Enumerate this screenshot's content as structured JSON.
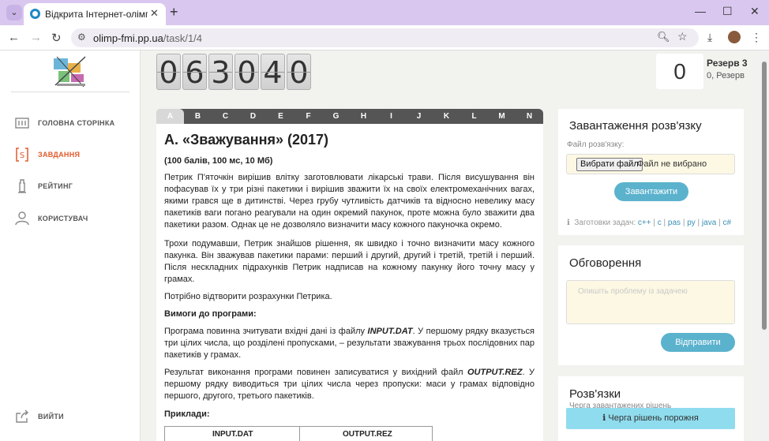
{
  "browser": {
    "tab_title": "Відкрита Інтернет-олімпіада Р",
    "url_host": "olimp-fmi.pp.ua",
    "url_path": "/task/1/4"
  },
  "sidebar": {
    "items": [
      {
        "label": "ГОЛОВНА СТОРІНКА",
        "icon": "dashboard-icon"
      },
      {
        "label": "ЗАВДАННЯ",
        "icon": "brackets-icon"
      },
      {
        "label": "РЕЙТИНГ",
        "icon": "tower-icon"
      },
      {
        "label": "КОРИСТУВАЧ",
        "icon": "user-icon"
      }
    ],
    "logout": "ВИЙТИ"
  },
  "timer": {
    "digits": [
      "0",
      "6",
      "3",
      "0",
      "4",
      "0"
    ]
  },
  "score": {
    "value": "0",
    "title": "Резерв 3",
    "subtitle": "0, Резерв"
  },
  "task_tabs": [
    "A",
    "B",
    "C",
    "D",
    "E",
    "F",
    "G",
    "H",
    "I",
    "J",
    "K",
    "L",
    "M",
    "N"
  ],
  "task": {
    "title": "A. «Зважування» (2017)",
    "limits": "(100 балів, 100 мс, 10 Мб)",
    "p1": "Петрик П'яточкін вирішив влітку заготовлювати лікарські трави. Після висушування він пофасував їх у три різні пакетики і вирішив зважити їх на своїх електромеханічних вагах, якими грався ще в дитинстві. Через грубу чутливість датчиків та відносно невелику масу пакетиків ваги погано реагували на один окремий пакунок, проте можна було зважити два пакетики разом. Однак це не дозволяло визначити масу кожного пакуночка окремо.",
    "p2": "Трохи подумавши, Петрик знайшов рішення, як швидко і точно визначити масу кожного пакунка. Він зважував пакетики парами: перший і другий, другий і третій, третій і перший. Після нескладних підрахунків Петрик надписав на кожному пакунку його точну масу у грамах.",
    "p3": "Потрібно відтворити розрахунки Петрика.",
    "req_heading": "Вимоги до програми:",
    "p4_pre": "Програма повинна зчитувати вхідні дані із файлу ",
    "p4_file": "INPUT.DAT",
    "p4_post": ". У першому рядку вказується три цілих числа, що розділені пропусками, – результати зважування трьох послідовних пар пакетиків у грамах.",
    "p5_pre": "Результат виконання програми повинен записуватися у вихідний файл ",
    "p5_file": "OUTPUT.REZ",
    "p5_post": ". У першому рядку виводиться три цілих числа через пропуски: маси у грамах відповідно першого, другого, третього пакетиків.",
    "examples_heading": "Приклади:",
    "table_headers": [
      "INPUT.DAT",
      "OUTPUT.REZ"
    ]
  },
  "upload": {
    "title": "Завантаження розв'язку",
    "file_label": "Файл розв'язку:",
    "choose_btn": "Вибрати файл",
    "no_file": "Файл не вибрано",
    "submit": "Завантажити",
    "templates_label": "Заготовки задач:",
    "templates": [
      "c++",
      "c",
      "pas",
      "py",
      "java",
      "c#"
    ]
  },
  "discussion": {
    "title": "Обговорення",
    "placeholder": "Опишіть проблему із задачею",
    "send": "Відправити"
  },
  "solutions": {
    "title": "Розв'язки",
    "subtitle": "Черга завантажених рішень",
    "queue_empty": "Черга рішень порожня"
  }
}
